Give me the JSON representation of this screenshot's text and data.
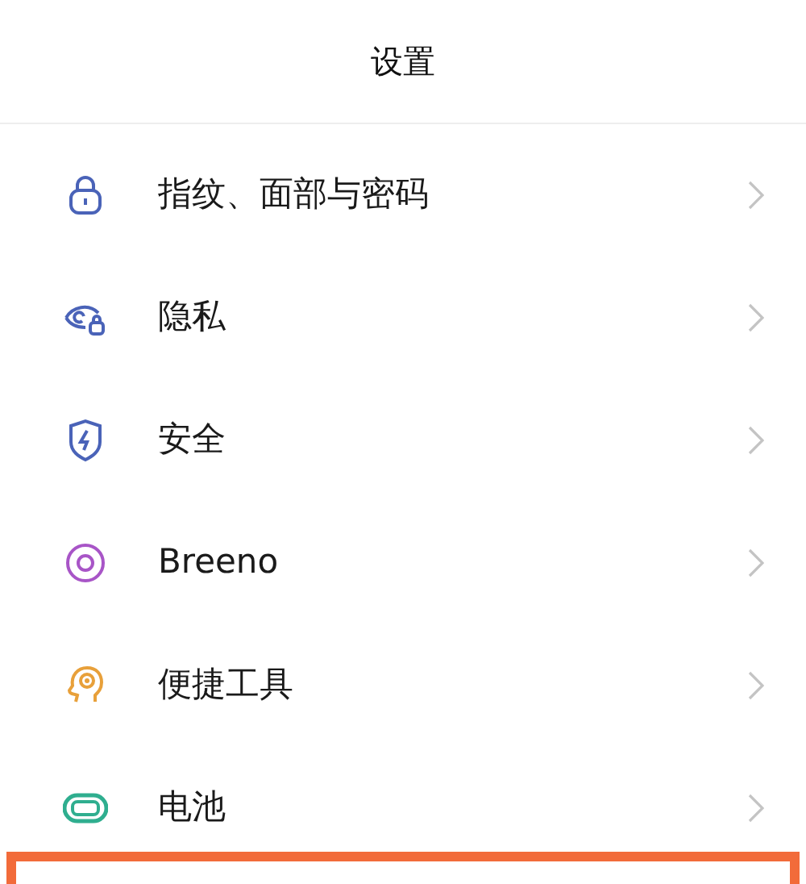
{
  "header": {
    "title": "设置"
  },
  "items": [
    {
      "label": "指纹、面部与密码",
      "kind": "lock",
      "color": "#4a63b8"
    },
    {
      "label": "隐私",
      "kind": "eye",
      "color": "#4a63b8"
    },
    {
      "label": "安全",
      "kind": "shield",
      "color": "#4a63b8"
    },
    {
      "label": "Breeno",
      "kind": "ring",
      "color": "#a855c7"
    },
    {
      "label": "便捷工具",
      "kind": "head",
      "color": "#e8a03a"
    },
    {
      "label": "电池",
      "kind": "battery",
      "color": "#2fae8f"
    }
  ]
}
